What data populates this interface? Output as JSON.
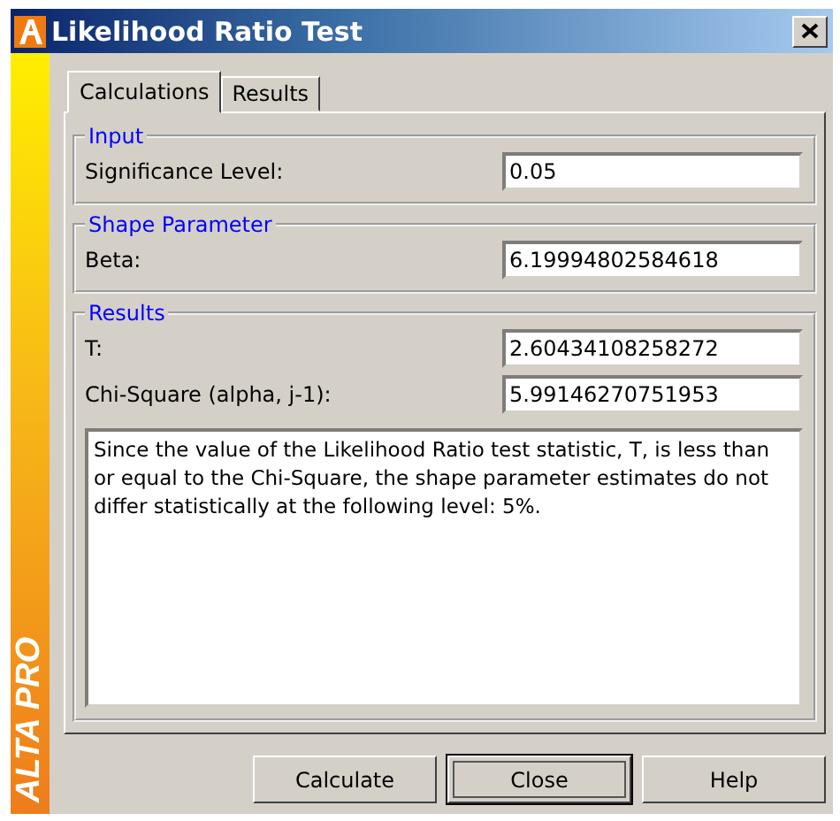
{
  "window": {
    "title": "Likelihood Ratio Test",
    "brand": "ALTA PRO"
  },
  "tabs": [
    {
      "label": "Calculations",
      "selected": true
    },
    {
      "label": "Results",
      "selected": false
    }
  ],
  "groups": [
    {
      "title": "Input",
      "fields": [
        {
          "label": "Significance Level:",
          "value": "0.05"
        }
      ]
    },
    {
      "title": "Shape Parameter",
      "fields": [
        {
          "label": "Beta:",
          "value": "6.19994802584618"
        }
      ]
    },
    {
      "title": "Results",
      "fields": [
        {
          "label": "T:",
          "value": "2.60434108258272"
        },
        {
          "label": "Chi-Square (alpha, j-1):",
          "value": "5.99146270751953"
        }
      ],
      "message": "Since the value of the Likelihood Ratio test statistic, T, is less than or equal to the Chi-Square, the shape parameter estimates do not differ statistically at the following level: 5%."
    }
  ],
  "buttons": [
    {
      "label": "Calculate",
      "focused": false
    },
    {
      "label": "Close",
      "focused": true
    },
    {
      "label": "Help",
      "focused": false
    }
  ]
}
